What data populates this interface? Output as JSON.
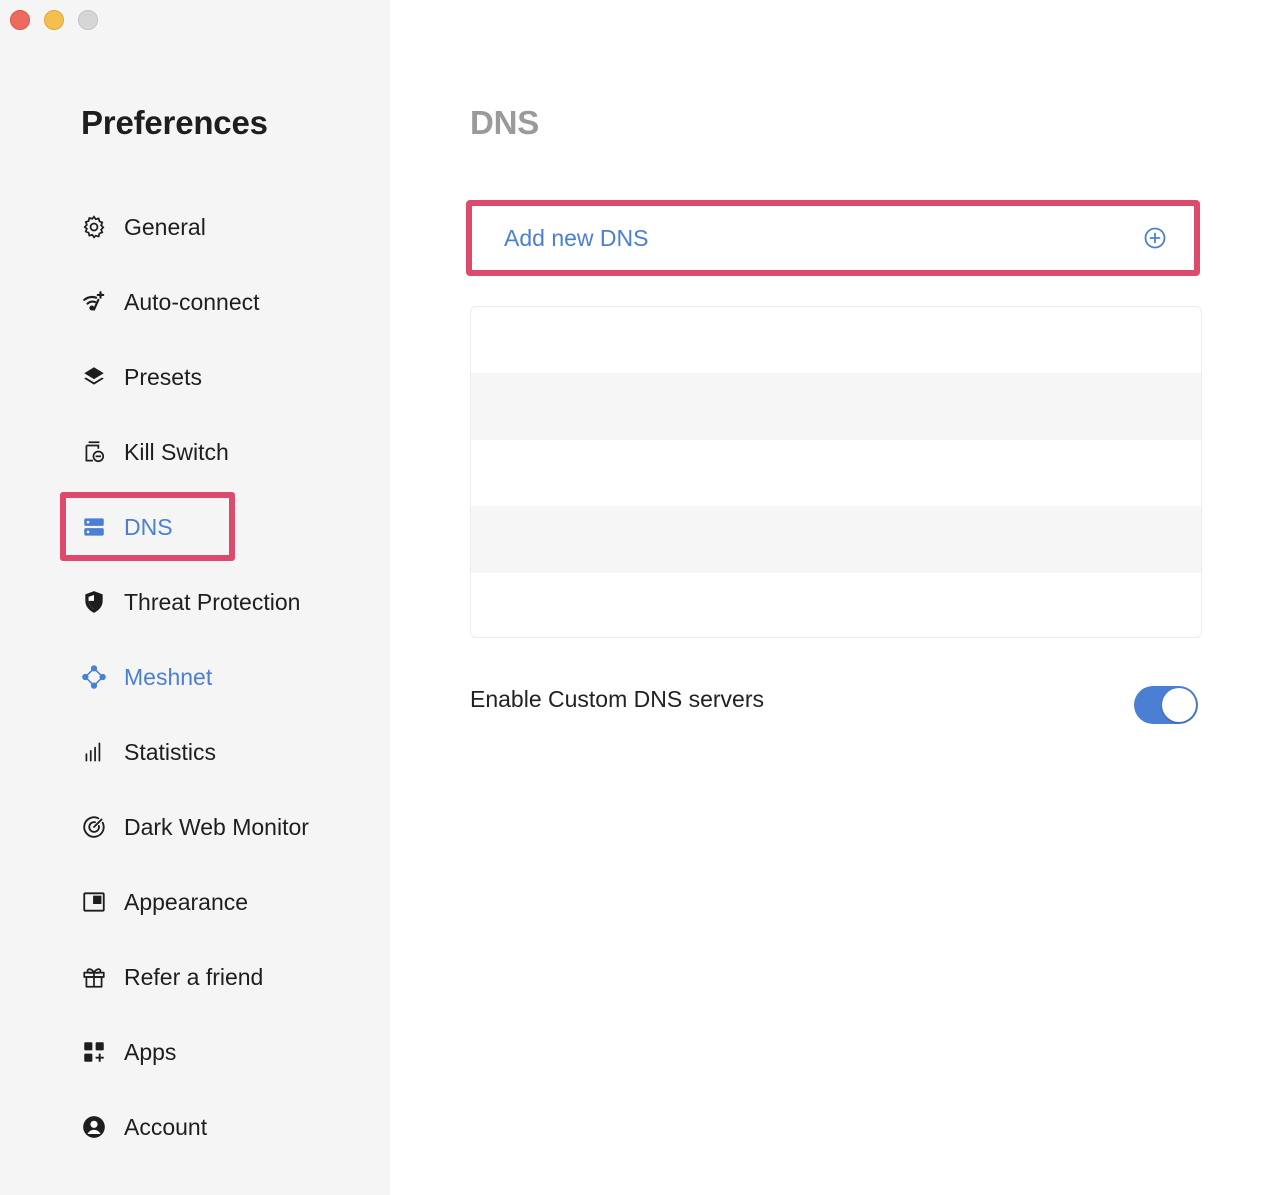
{
  "sidebar": {
    "title": "Preferences",
    "items": [
      {
        "label": "General",
        "icon": "gear-icon"
      },
      {
        "label": "Auto-connect",
        "icon": "wifi-sparkle-icon"
      },
      {
        "label": "Presets",
        "icon": "layers-icon"
      },
      {
        "label": "Kill Switch",
        "icon": "kill-switch-icon"
      },
      {
        "label": "DNS",
        "icon": "server-icon",
        "active": true
      },
      {
        "label": "Threat Protection",
        "icon": "shield-icon"
      },
      {
        "label": "Meshnet",
        "icon": "meshnet-icon",
        "accent": true
      },
      {
        "label": "Statistics",
        "icon": "bar-chart-icon"
      },
      {
        "label": "Dark Web Monitor",
        "icon": "radar-icon"
      },
      {
        "label": "Appearance",
        "icon": "appearance-icon"
      },
      {
        "label": "Refer a friend",
        "icon": "gift-icon"
      },
      {
        "label": "Apps",
        "icon": "apps-grid-icon"
      },
      {
        "label": "Account",
        "icon": "user-circle-icon"
      }
    ]
  },
  "main": {
    "title": "DNS",
    "add_dns_label": "Add new DNS",
    "dns_entries": [
      "",
      "",
      "",
      "",
      ""
    ],
    "custom_dns_toggle": {
      "label": "Enable Custom DNS servers",
      "enabled": true
    }
  },
  "colors": {
    "accent": "#4a7fd4",
    "highlight": "#dc4b6b",
    "sidebar_bg": "#f5f5f5"
  }
}
